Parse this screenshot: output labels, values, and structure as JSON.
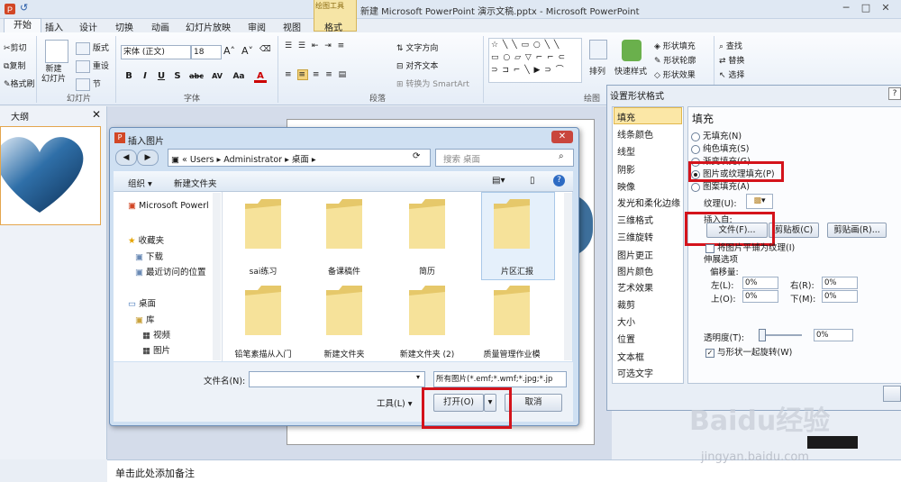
{
  "window": {
    "title": "新建 Microsoft PowerPoint 演示文稿.pptx - Microsoft PowerPoint",
    "context_tab_group": "绘图工具"
  },
  "ribbon": {
    "tabs": [
      "开始",
      "插入",
      "设计",
      "切换",
      "动画",
      "幻灯片放映",
      "审阅",
      "视图",
      "格式"
    ],
    "clipboard": {
      "cut": "剪切",
      "copy": "复制",
      "format_painter": "格式刷"
    },
    "slides": {
      "new_slide": "新建\n幻灯片",
      "layout": "版式",
      "reset": "重设",
      "section": "节",
      "group": "幻灯片"
    },
    "font": {
      "name": "宋体 (正文)",
      "size": "18",
      "group": "字体",
      "buttons": [
        "B",
        "I",
        "U",
        "S",
        "abc",
        "AV",
        "Aa",
        "A"
      ]
    },
    "paragraph": {
      "text_direction": "文字方向",
      "align_text": "对齐文本",
      "to_smartart": "转换为 SmartArt",
      "group": "段落"
    },
    "drawing": {
      "arrange": "排列",
      "quick_styles": "快速样式",
      "shape_fill": "形状填充",
      "shape_outline": "形状轮廓",
      "shape_effects": "形状效果",
      "group": "绘图"
    },
    "editing": {
      "find": "查找",
      "replace": "替换",
      "select": "选择"
    }
  },
  "outline": {
    "tab": "大纲"
  },
  "notes": {
    "placeholder": "单击此处添加备注"
  },
  "insert_picture_dialog": {
    "title": "插入图片",
    "address_path": [
      "«",
      "Users",
      "Administrator",
      "桌面"
    ],
    "search_placeholder": "搜索 桌面",
    "toolbar": {
      "organize": "组织",
      "new_folder": "新建文件夹"
    },
    "nav": [
      {
        "label": "Microsoft Powerl",
        "icon": "ppt-icon"
      },
      {
        "label": "收藏夹",
        "icon": "star-icon"
      },
      {
        "label": "下载",
        "icon": "folder-icon"
      },
      {
        "label": "最近访问的位置",
        "icon": "folder-icon"
      },
      {
        "label": "桌面",
        "icon": "desktop-icon"
      },
      {
        "label": "库",
        "icon": "library-icon"
      },
      {
        "label": "视频",
        "icon": "video-icon"
      },
      {
        "label": "图片",
        "icon": "picture-icon"
      }
    ],
    "folders": [
      "sai练习",
      "备课稿件",
      "简历",
      "片区汇报",
      "铅笔素描从入门",
      "新建文件夹",
      "新建文件夹 (2)",
      "质量管理作业模"
    ],
    "filename_label": "文件名(N):",
    "filename_value": "",
    "file_type": "所有图片(*.emf;*.wmf;*.jpg;*.jp",
    "tools": "工具(L)",
    "open": "打开(O)",
    "cancel": "取消"
  },
  "format_shape_dialog": {
    "title": "设置形状格式",
    "nav": [
      "填充",
      "线条颜色",
      "线型",
      "阴影",
      "映像",
      "发光和柔化边缘",
      "三维格式",
      "三维旋转",
      "图片更正",
      "图片颜色",
      "艺术效果",
      "裁剪",
      "大小",
      "位置",
      "文本框",
      "可选文字"
    ],
    "heading": "填充",
    "fill_options": [
      "无填充(N)",
      "纯色填充(S)",
      "渐变填充(G)",
      "图片或纹理填充(P)",
      "图案填充(A)"
    ],
    "selected_fill": "图片或纹理填充(P)",
    "texture_label": "纹理(U):",
    "insert_from": "插入自:",
    "file_btn": "文件(F)...",
    "clipboard_btn": "剪贴板(C)",
    "clipart_btn": "剪贴画(R)...",
    "tile_check": "将图片平铺为纹理(I)",
    "stretch_options": "伸展选项",
    "offsets": "偏移量:",
    "left_label": "左(L):",
    "left_value": "0%",
    "right_label": "右(R):",
    "right_value": "0%",
    "top_label": "上(O):",
    "top_value": "0%",
    "bottom_label": "下(M):",
    "bottom_value": "0%",
    "transparency_label": "透明度(T):",
    "transparency_value": "0%",
    "rotate_check": "与形状一起旋转(W)"
  },
  "watermark": {
    "logo": "Baidu经验",
    "url": "jingyan.baidu.com"
  },
  "colors": {
    "highlight_red": "#d4131b",
    "ribbon_blue": "#dfe8f3"
  }
}
